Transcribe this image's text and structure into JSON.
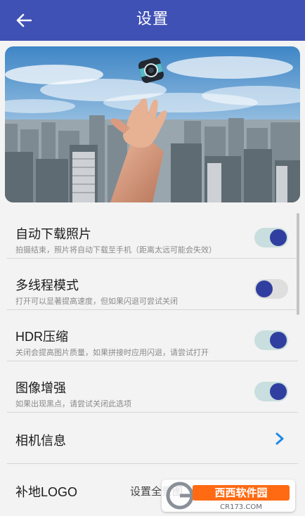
{
  "app_bar": {
    "title": "设置",
    "back_icon": "arrow-left-icon",
    "color": "#3f51b5"
  },
  "hero": {
    "description_icon": "hand-tossing-camera-city-photo"
  },
  "settings": [
    {
      "title": "自动下载照片",
      "subtitle": "拍摄结束，照片将自动下载至手机（距离太远可能会失效）",
      "toggle": true
    },
    {
      "title": "多线程模式",
      "subtitle": "打开可以显著提高速度，但如果闪退可尝试关闭",
      "toggle": false
    },
    {
      "title": "HDR压缩",
      "subtitle": "关闭会提高图片质量，如果拼接时应用闪退，请尝试打开",
      "toggle": true
    },
    {
      "title": "图像增强",
      "subtitle": "如果出现黑点，请尝试关闭此选项",
      "toggle": true
    }
  ],
  "camera_info": {
    "title": "相机信息",
    "chevron_icon": "chevron-right-icon"
  },
  "logo_row": {
    "title": "补地LOGO",
    "value": "设置全景图"
  },
  "watermark": {
    "brand": "西西软件园",
    "url": "CR173.COM"
  },
  "colors": {
    "accent": "#303f9f",
    "toggle_on_track": "#c9dede",
    "toggle_off_track": "#dedede",
    "chevron": "#1e88e5"
  }
}
